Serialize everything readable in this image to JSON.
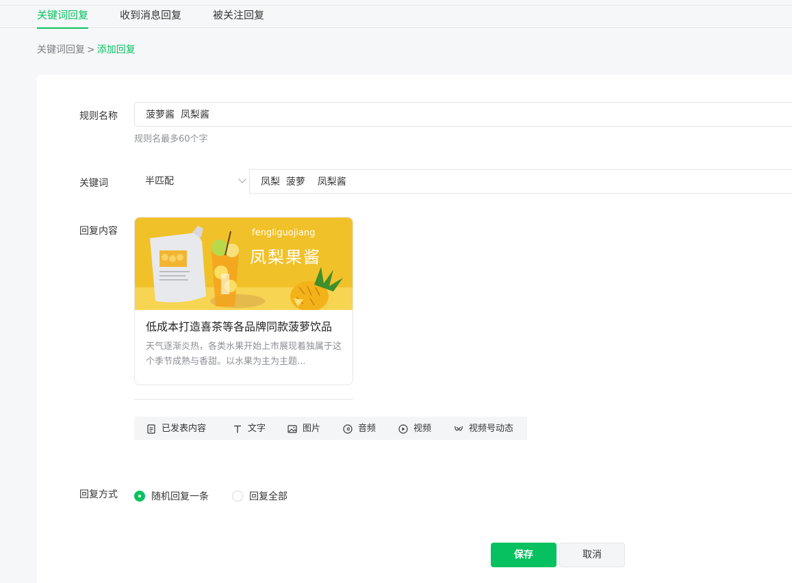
{
  "tabs": [
    {
      "label": "关键词回复",
      "active": true
    },
    {
      "label": "收到消息回复",
      "active": false
    },
    {
      "label": "被关注回复",
      "active": false
    }
  ],
  "breadcrumb": {
    "parent": "关键词回复",
    "separator": ">",
    "current": "添加回复"
  },
  "form": {
    "rule_name": {
      "label": "规则名称",
      "value": "菠萝酱  凤梨酱",
      "hint": "规则名最多60个字"
    },
    "keyword": {
      "label": "关键词",
      "match_type": "半匹配",
      "value": "凤梨  菠萝    凤梨酱"
    },
    "reply_content": {
      "label": "回复内容",
      "card": {
        "cover_text_en": "fengliguojiang",
        "cover_text_cn": "凤梨果酱",
        "title": "低成本打造喜茶等各品牌同款菠萝饮品",
        "desc": "天气逐渐炎热，各类水果开始上市展现着独属于这个季节成熟与香甜。以水果为主为主题..."
      },
      "toolbar": [
        {
          "label": "已发表内容",
          "icon": "document-icon"
        },
        {
          "label": "文字",
          "icon": "text-icon"
        },
        {
          "label": "图片",
          "icon": "image-icon"
        },
        {
          "label": "音频",
          "icon": "audio-icon"
        },
        {
          "label": "视频",
          "icon": "video-icon"
        },
        {
          "label": "视频号动态",
          "icon": "channels-icon"
        }
      ]
    },
    "reply_mode": {
      "label": "回复方式",
      "options": [
        {
          "label": "随机回复一条",
          "selected": true
        },
        {
          "label": "回复全部",
          "selected": false
        }
      ]
    }
  },
  "actions": {
    "save": "保存",
    "cancel": "取消"
  },
  "colors": {
    "accent": "#07c160",
    "cover_bg": "#f1c12a"
  }
}
